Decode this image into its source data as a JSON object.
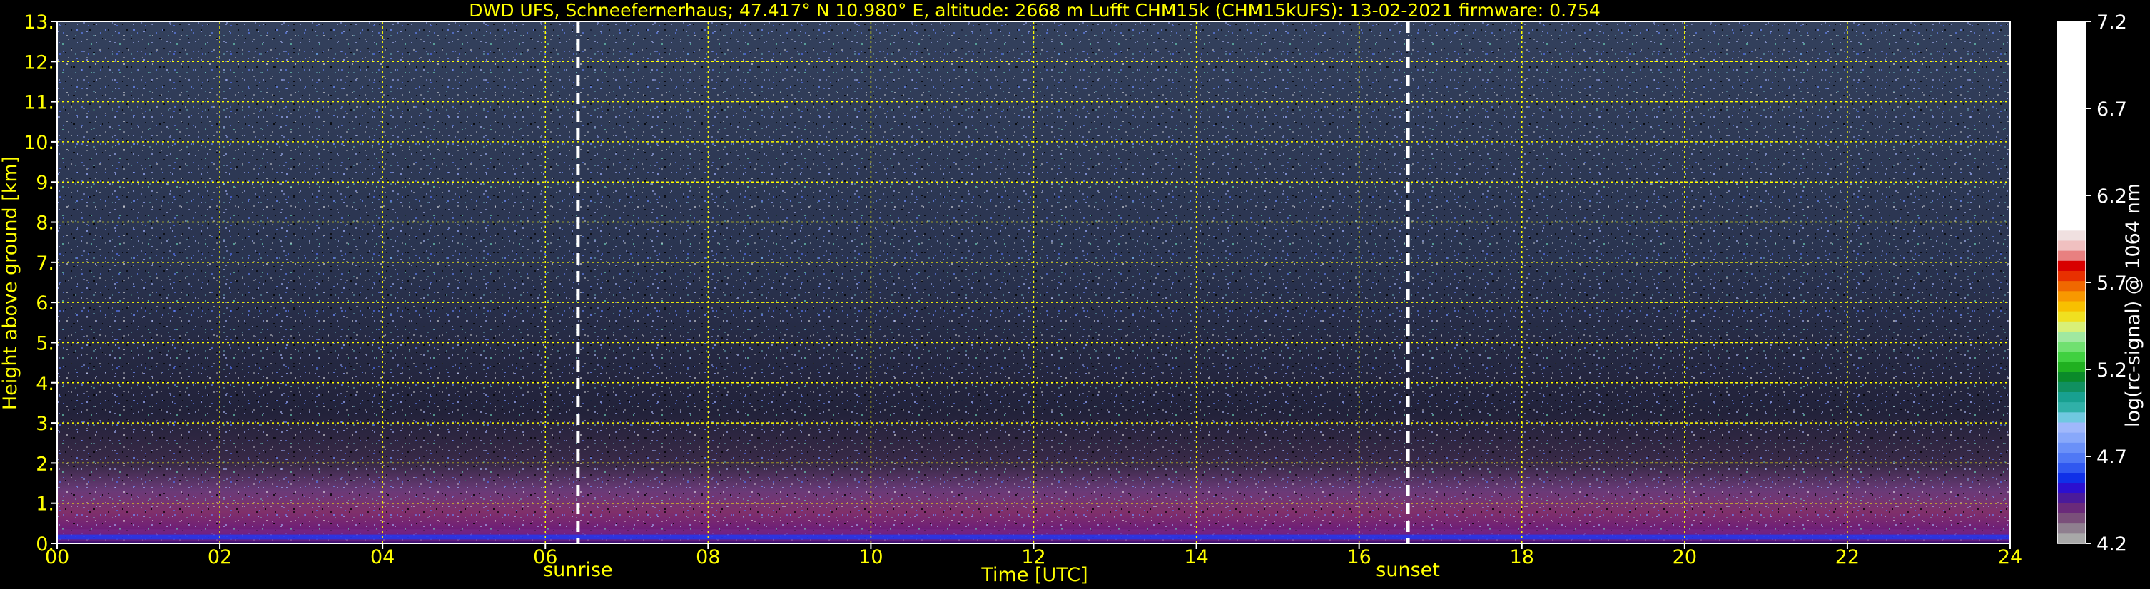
{
  "chart_data": {
    "type": "heatmap",
    "title": "DWD UFS, Schneefernerhaus; 47.417° N 10.980° E, altitude: 2668 m    Lufft CHM15k (CHM15kUFS): 13-02-2021    firmware: 0.754",
    "xlabel": "Time [UTC]",
    "ylabel": "Height above ground [km]",
    "xlim": [
      0,
      24
    ],
    "ylim": [
      0,
      13
    ],
    "x_ticks": [
      0,
      2,
      4,
      6,
      8,
      10,
      12,
      14,
      16,
      18,
      20,
      22,
      24
    ],
    "x_tick_labels": [
      "00",
      "02",
      "04",
      "06",
      "08",
      "10",
      "12",
      "14",
      "16",
      "18",
      "20",
      "22",
      "24"
    ],
    "y_ticks": [
      0,
      1,
      2,
      3,
      4,
      5,
      6,
      7,
      8,
      9,
      10,
      11,
      12,
      13
    ],
    "y_tick_labels": [
      "0.",
      "1.",
      "2.",
      "3.",
      "4.",
      "5.",
      "6.",
      "7.",
      "8.",
      "9.",
      "10.",
      "11.",
      "12.",
      "13."
    ],
    "grid": true,
    "markers": [
      {
        "name": "sunrise",
        "label": "sunrise",
        "x": 6.4
      },
      {
        "name": "sunset",
        "label": "sunset",
        "x": 16.6
      }
    ],
    "colorbar": {
      "label": "log(rc-signal) @ 1064 nm",
      "range": [
        4.2,
        7.2
      ],
      "tick_values": [
        4.2,
        4.7,
        5.2,
        5.7,
        6.2,
        6.7,
        7.2
      ],
      "tick_labels": [
        "4.2",
        "4.7",
        "5.2",
        "5.7",
        "6.2",
        "6.7",
        "7.2"
      ],
      "colors": [
        "#a8a8a8",
        "#8f7f8f",
        "#7a4f7a",
        "#6a2a7a",
        "#4a1a9a",
        "#2b0fd0",
        "#1030e8",
        "#3058f0",
        "#4f78f5",
        "#6a90f8",
        "#88a8fa",
        "#a0b8fb",
        "#70c8e0",
        "#30b0a8",
        "#18a090",
        "#109060",
        "#0a8a2a",
        "#20b020",
        "#40d040",
        "#70e070",
        "#a0e8a0",
        "#d8f078",
        "#f0e020",
        "#f8c000",
        "#f89800",
        "#f06800",
        "#e83000",
        "#d80000",
        "#e88080",
        "#f0c0c0",
        "#f0e0e0",
        "#ffffff"
      ]
    }
  },
  "colors": {
    "text": "#ffff00",
    "axes": "#ffffff",
    "grid": "#ffff00",
    "marker_line": "#ffffff",
    "background": "#000000"
  }
}
